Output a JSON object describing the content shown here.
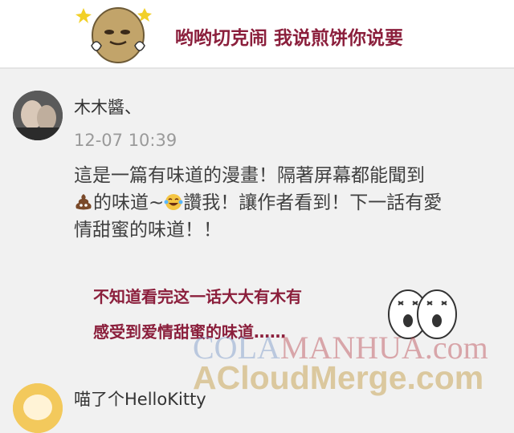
{
  "banner": {
    "text": "哟哟切克闹 我说煎饼你说要",
    "sticker_icon": "potato-sticker-icon"
  },
  "comment": {
    "username": "木木醬、",
    "timestamp": "12-07 10:39",
    "line1": "這是一篇有味道的漫畫！隔著屏幕都能聞到",
    "line2_a": "的味道~",
    "line2_b": "讚我！讓作者看到！下一話有愛",
    "line3": "情甜蜜的味道！！",
    "emoji_1": "poop-emoji-icon",
    "emoji_2": "tears-of-joy-emoji-icon"
  },
  "caption": {
    "line1": "不知道看完这一话大大有木有",
    "line2": "感受到爱情甜蜜的味道……",
    "sticker_icon": "shocked-blobs-sticker-icon"
  },
  "watermark": {
    "line1_a": "COLA",
    "line1_b": "MANHUA.com",
    "line2": "ACloudMerge.com"
  },
  "next_comment": {
    "username": "喵了个HelloKitty"
  },
  "colors": {
    "accent_text": "#8b1f3c",
    "body_text": "#404040",
    "muted_text": "#9a9a9a",
    "background": "#f1f1f1"
  }
}
